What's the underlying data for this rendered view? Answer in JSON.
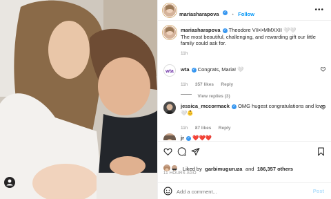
{
  "header": {
    "username": "mariasharapova",
    "follow_label": "Follow",
    "separator": "•",
    "more_label": "•••"
  },
  "caption": {
    "username": "mariasharapova",
    "line1": "Theodore VII•I•MMXXII 🤍🤍",
    "line2": "The most beautiful, challenging, and rewarding gift our little",
    "line3": "family could ask for.",
    "time": "11h"
  },
  "comments": [
    {
      "username": "wta",
      "text": "Congrats, Maria! 🤍",
      "time": "11h",
      "likes": "357 likes",
      "reply": "Reply",
      "view_replies": "View replies (3)"
    },
    {
      "username": "jessica_mccormack",
      "text": "OMG hugest congratulations and love",
      "text2": "🤍👶",
      "time": "11h",
      "likes": "87 likes",
      "reply": "Reply"
    },
    {
      "username": "jr",
      "text": "❤️❤️❤️"
    }
  ],
  "likes": {
    "prefix": "Liked by",
    "user": "garbimuguruza",
    "middle": "and",
    "count": "186,357 others"
  },
  "post_time": "11 HOURS AGO",
  "comment_box": {
    "placeholder": "Add a comment...",
    "post_label": "Post"
  },
  "icons": {
    "brand_blue": "#0095f6",
    "verified": "#3897f0"
  }
}
